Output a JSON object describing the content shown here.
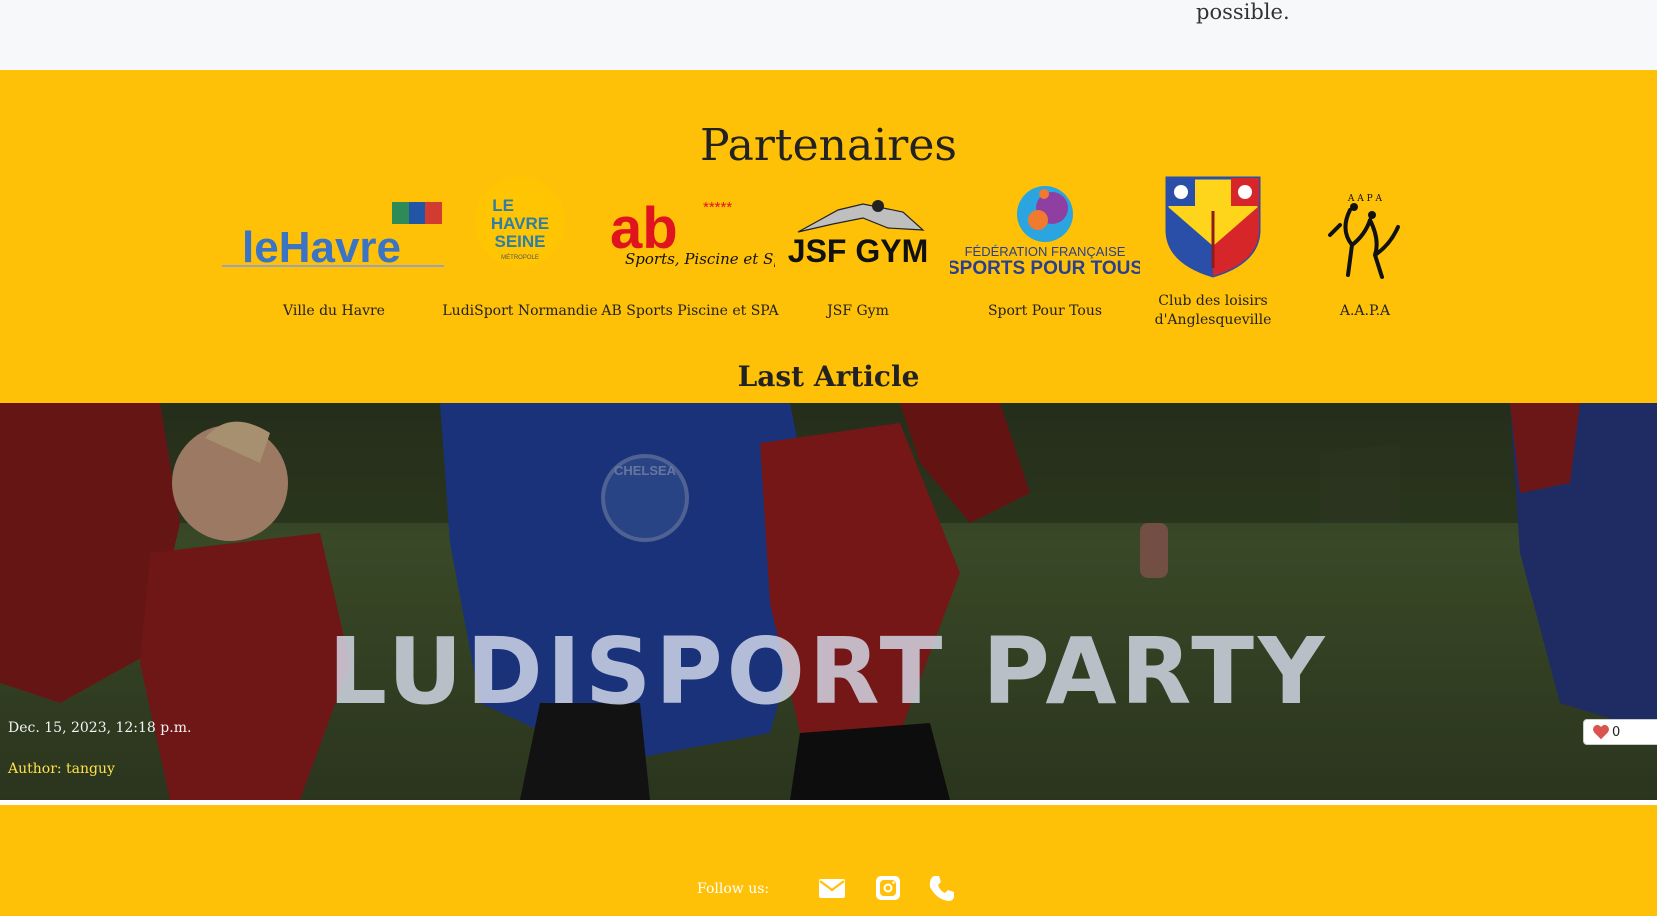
{
  "top": {
    "tail_text": "possible."
  },
  "partners": {
    "title": "Partenaires",
    "items": [
      {
        "name": "Ville du Havre"
      },
      {
        "name": "LudiSport Normandie"
      },
      {
        "name": "AB Sports Piscine et SPA"
      },
      {
        "name": "JSF Gym"
      },
      {
        "name": "Sport Pour Tous"
      },
      {
        "name": "Club des loisirs d'Anglesqueville"
      },
      {
        "name": "A.A.P.A"
      }
    ],
    "logo_text": {
      "le_havre": "leHavre",
      "havre_seine_1": "LE",
      "havre_seine_2": "HAVRE",
      "havre_seine_3": "SEINE",
      "havre_seine_4": "MÉTROPOLE",
      "ab_main": "ab",
      "ab_stars": "*****",
      "ab_sub": "Sports, Piscine et Spa",
      "jsf": "JSF GYM",
      "ffspt_1": "FÉDÉRATION FRANÇAISE",
      "ffspt_2": "SPORTS POUR TOUS",
      "aapa": "A A P A"
    }
  },
  "last_article": {
    "section_title": "Last Article",
    "title": "LUDISPORT PARTY",
    "date": "Dec. 15, 2023, 12:18 p.m.",
    "author": "Author: tanguy",
    "likes": "0",
    "shirt_text": "CHELSEA"
  },
  "footer": {
    "follow_label": "Follow us:",
    "icons": [
      "envelope-icon",
      "instagram-icon",
      "phone-icon"
    ]
  },
  "colors": {
    "accent_yellow": "#ffc107",
    "author_yellow": "#ffe14a",
    "heart_red": "#d9534f"
  }
}
